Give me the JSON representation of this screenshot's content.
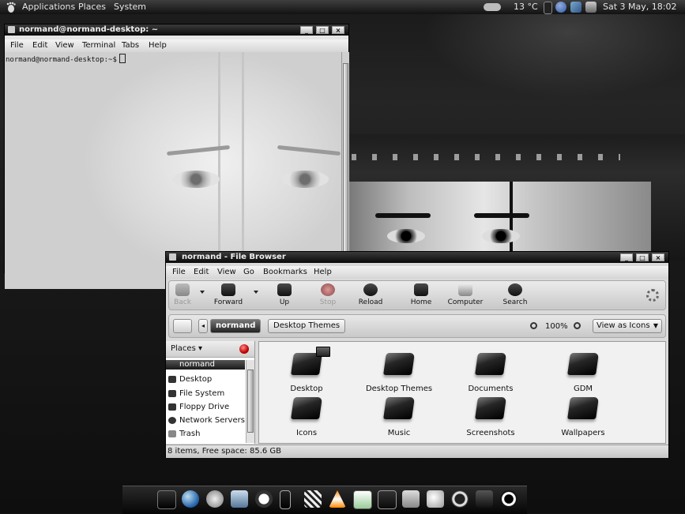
{
  "top_panel": {
    "menus": [
      "Applications",
      "Places",
      "System"
    ],
    "weather": "13 °C",
    "clock": "Sat  3 May, 18:02"
  },
  "terminal": {
    "title": "normand@normand-desktop: ~",
    "menu": [
      "File",
      "Edit",
      "View",
      "Terminal",
      "Tabs",
      "Help"
    ],
    "prompt": "normand@normand-desktop:~$"
  },
  "file_browser": {
    "title": "normand - File Browser",
    "menu": [
      "File",
      "Edit",
      "View",
      "Go",
      "Bookmarks",
      "Help"
    ],
    "toolbar": {
      "back": "Back",
      "forward": "Forward",
      "up": "Up",
      "stop": "Stop",
      "reload": "Reload",
      "home": "Home",
      "computer": "Computer",
      "search": "Search"
    },
    "location": {
      "crumb_home": "normand",
      "crumb_current": "Desktop Themes",
      "zoom": "100%",
      "view_mode": "View as Icons"
    },
    "sidebar": {
      "header": "Places ▾",
      "items": [
        "normand",
        "Desktop",
        "File System",
        "Floppy Drive",
        "Network Servers",
        "Trash"
      ]
    },
    "folders": [
      "Desktop",
      "Desktop Themes",
      "Documents",
      "GDM",
      "Icons",
      "Music",
      "Screenshots",
      "Wallpapers"
    ],
    "status": "8 items, Free space: 85.6 GB"
  },
  "window_buttons": {
    "minimize": "_",
    "maximize": "□",
    "close": "×"
  },
  "dock_icons": [
    "terminal-icon",
    "globe-icon",
    "gear-icon",
    "document-icon",
    "clock-icon",
    "phone-icon",
    "clapper-icon",
    "vlc-cone-icon",
    "spreadsheet-icon",
    "monitor-icon",
    "trash-icon",
    "gimp-icon",
    "headphones-icon",
    "drive-icon",
    "power-icon"
  ]
}
